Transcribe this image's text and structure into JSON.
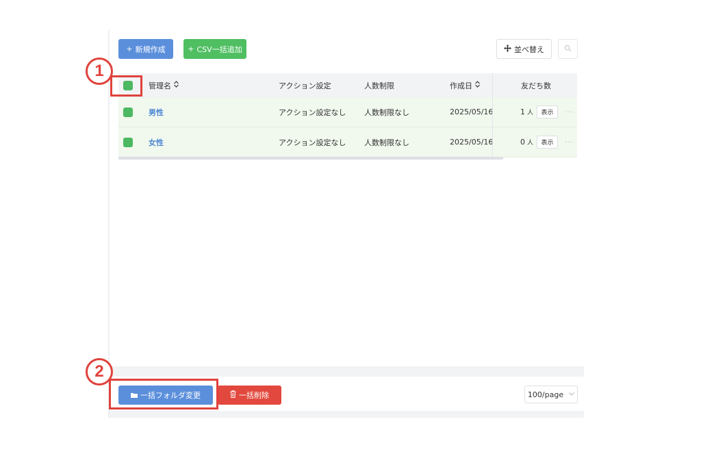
{
  "toolbar": {
    "new_label": "新規作成",
    "csv_label": "CSV一括追加",
    "sort_label": "並べ替え"
  },
  "table": {
    "headers": {
      "name": "管理名",
      "action": "アクション設定",
      "limit": "人数制限",
      "date": "作成日",
      "friends": "友だち数"
    },
    "rows": [
      {
        "name": "男性",
        "action": "アクション設定なし",
        "limit": "人数制限なし",
        "date": "2025/05/16",
        "friends": "1",
        "unit": "人",
        "show": "表示"
      },
      {
        "name": "女性",
        "action": "アクション設定なし",
        "limit": "人数制限なし",
        "date": "2025/05/16",
        "friends": "0",
        "unit": "人",
        "show": "表示"
      }
    ]
  },
  "footer": {
    "folder_label": "一括フォルダ変更",
    "delete_label": "一括削除",
    "page_size": "100/page"
  },
  "callouts": [
    "1",
    "2"
  ],
  "colors": {
    "primary": "#5b8fdb",
    "success": "#4fbf62",
    "danger": "#e2483d",
    "highlight": "#e0423c",
    "row_selected": "#f1f8ee"
  }
}
